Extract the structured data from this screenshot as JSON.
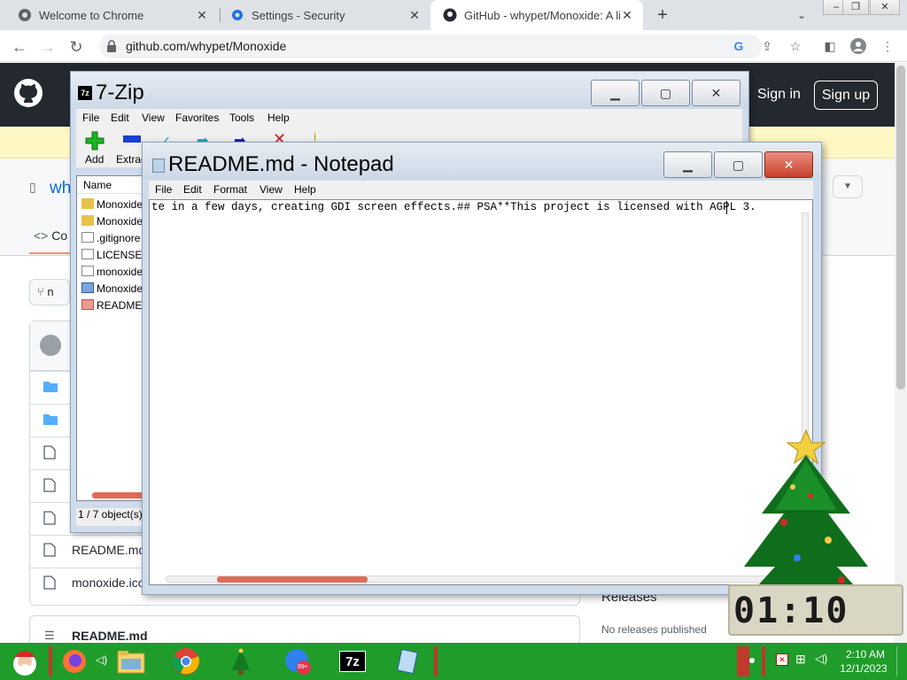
{
  "browser": {
    "tabs": [
      {
        "title": "Welcome to Chrome",
        "active": false
      },
      {
        "title": "Settings - Security",
        "active": false
      },
      {
        "title": "GitHub - whypet/Monoxide: A lit",
        "active": true
      }
    ],
    "url": "github.com/whypet/Monoxide"
  },
  "github": {
    "sign_in": "Sign in",
    "sign_up": "Sign up",
    "repo_owner_partial": "wh",
    "code_tab": "Co",
    "branch_partial": "n",
    "files": [
      {
        "name": "",
        "type": "folder"
      },
      {
        "name": "",
        "type": "folder"
      },
      {
        "name": "",
        "type": "file"
      },
      {
        "name": "",
        "type": "file"
      },
      {
        "name": "",
        "type": "file"
      },
      {
        "name": "README.md",
        "type": "file"
      },
      {
        "name": "monoxide.ico",
        "type": "file"
      }
    ],
    "readme_title": "README.md",
    "releases_heading": "Releases",
    "no_releases": "No releases published"
  },
  "sevenzip": {
    "title": "7-Zip",
    "menu": [
      "File",
      "Edit",
      "View",
      "Favorites",
      "Tools",
      "Help"
    ],
    "toolbar": {
      "add": "Add",
      "extract": "Extrac"
    },
    "column_name": "Name",
    "rows": [
      {
        "name": "Monoxide",
        "kind": "folder"
      },
      {
        "name": "Monoxide",
        "kind": "folder"
      },
      {
        "name": ".gitignore",
        "kind": "file"
      },
      {
        "name": "LICENSE",
        "kind": "file"
      },
      {
        "name": "monoxide",
        "kind": "file"
      },
      {
        "name": "Monoxide",
        "kind": "project"
      },
      {
        "name": "README.",
        "kind": "readme"
      }
    ],
    "status": "1 / 7 object(s)"
  },
  "notepad": {
    "title": "README.md - Notepad",
    "menu": [
      "File",
      "Edit",
      "Format",
      "View",
      "Help"
    ],
    "content": "te in a few days, creating GDI screen effects.## PSA**This project is licensed with AGPL 3."
  },
  "taskbar": {
    "time": "2:10 AM",
    "date": "12/1/2023",
    "badge": "99+"
  },
  "desktop_clock": "01:10",
  "colors": {
    "github_dark": "#24292f",
    "taskbar_green": "#1f9c2a",
    "accent_red": "#e06a5a"
  }
}
